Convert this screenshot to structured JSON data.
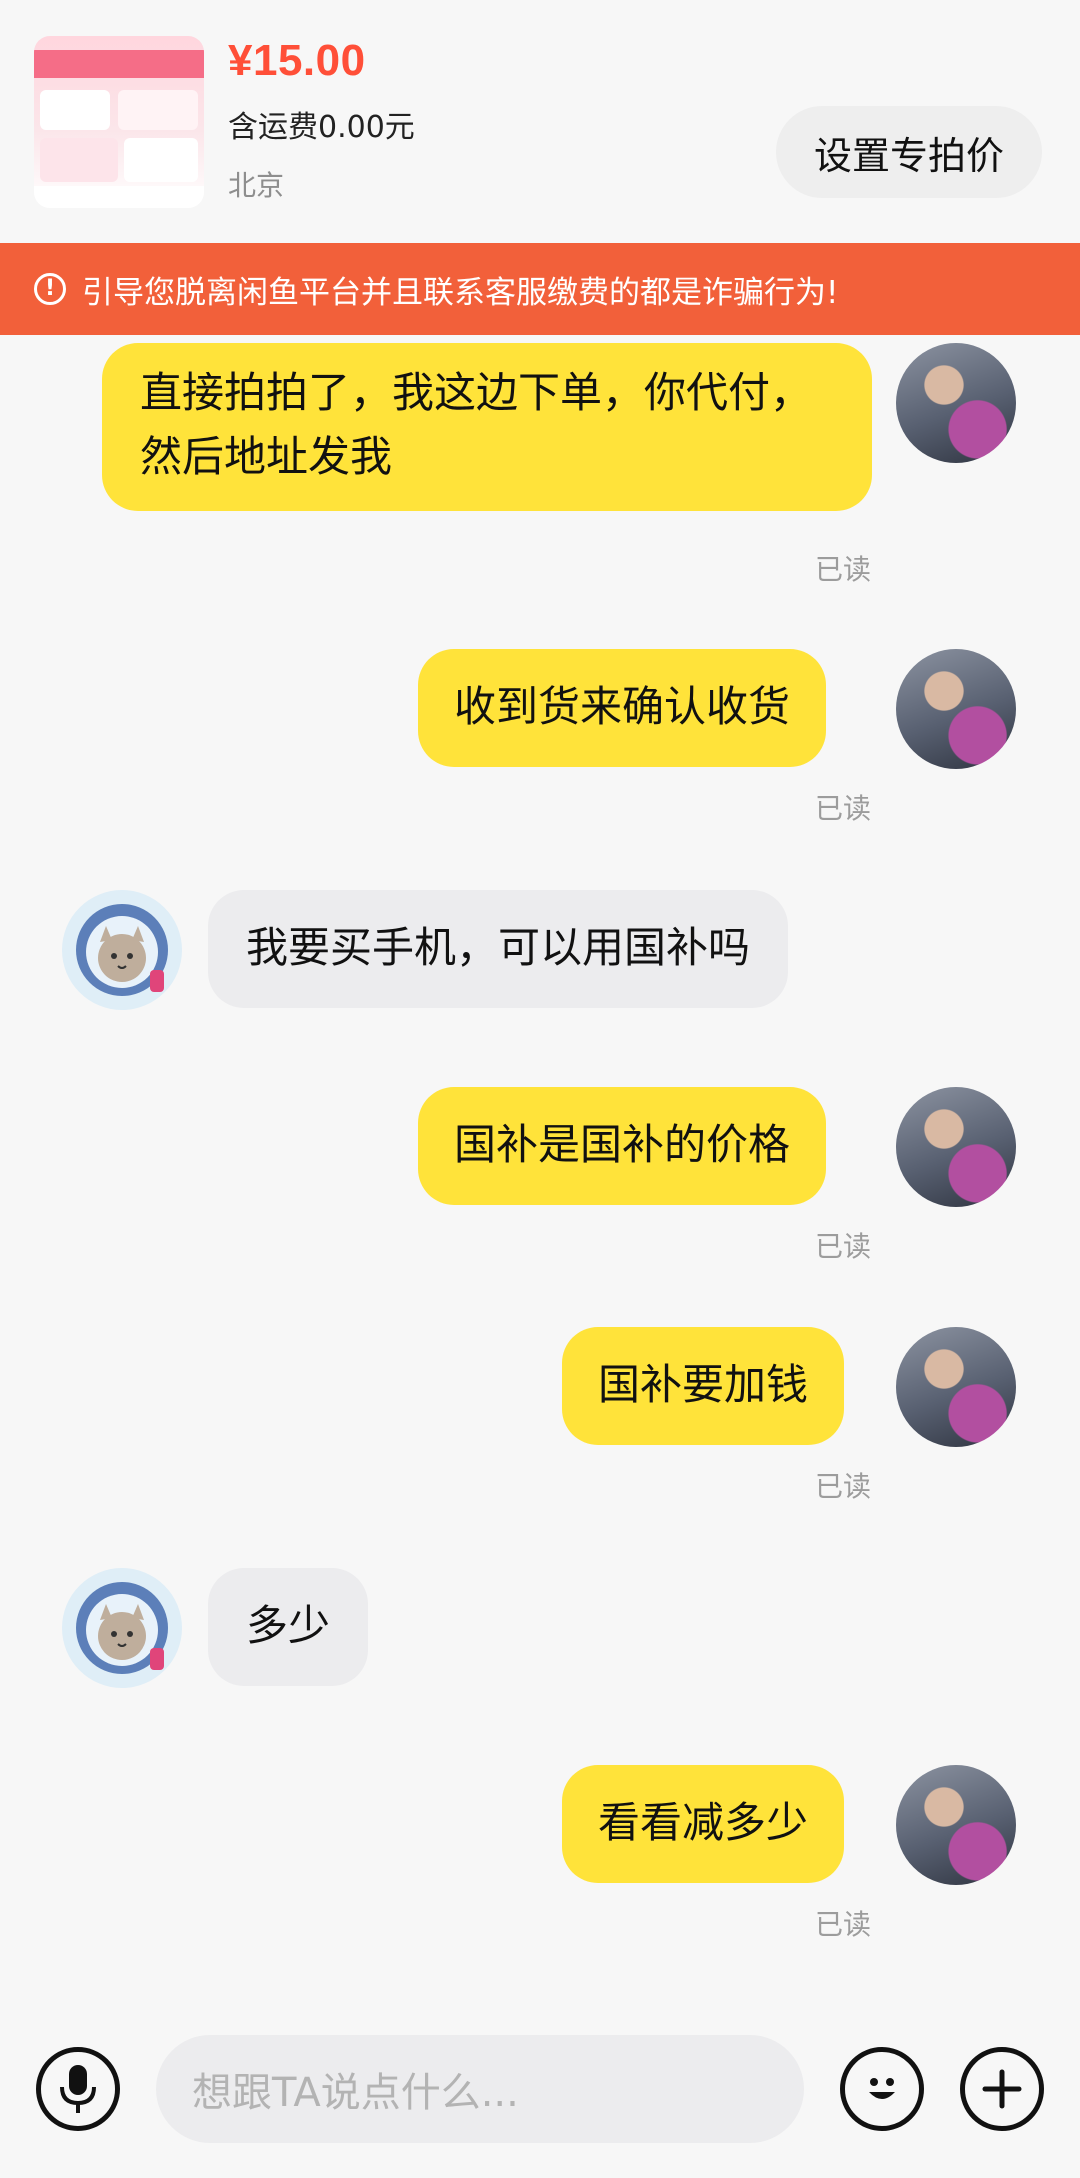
{
  "product": {
    "price": "¥15.00",
    "shipping": "含运费0.00元",
    "location": "北京",
    "special_price_label": "设置专拍价"
  },
  "warning": {
    "text": "引导您脱离闲鱼平台并且联系客服缴费的都是诈骗行为!"
  },
  "messages": [
    {
      "from": "me",
      "text": "直接拍拍了，我这边下单，你代付，然后地址发我",
      "status": "已读"
    },
    {
      "from": "me",
      "text": "收到货来确认收货",
      "status": "已读"
    },
    {
      "from": "other",
      "text": "我要买手机，可以用国补吗"
    },
    {
      "from": "me",
      "text": "国补是国补的价格",
      "status": "已读"
    },
    {
      "from": "me",
      "text": "国补要加钱",
      "status": "已读"
    },
    {
      "from": "other",
      "text": "多少"
    },
    {
      "from": "me",
      "text": "看看减多少",
      "status": "已读"
    }
  ],
  "input": {
    "placeholder": "想跟TA说点什么..."
  },
  "colors": {
    "my_bubble": "#ffe33a",
    "other_bubble": "#ececee",
    "warning_bg": "#f2603a",
    "price": "#ff4f38"
  },
  "icons": [
    "microphone-icon",
    "emoji-icon",
    "plus-icon",
    "warning-icon"
  ]
}
